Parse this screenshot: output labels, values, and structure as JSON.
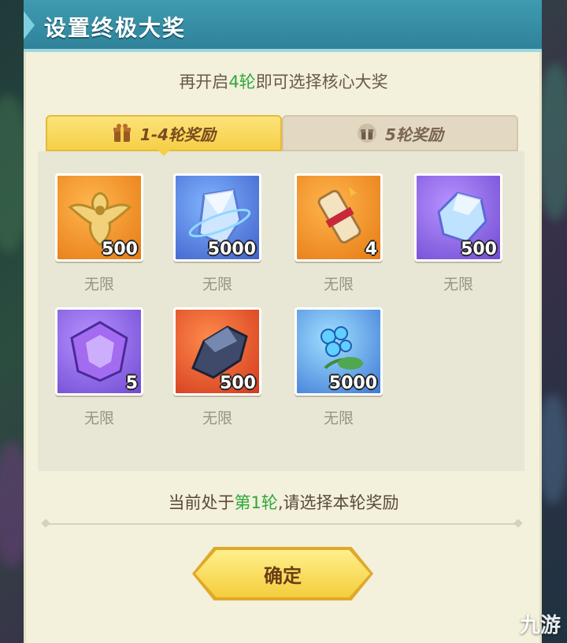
{
  "dialog": {
    "title": "设置终极大奖",
    "subtitle_prefix": "再开启",
    "subtitle_highlight": "4轮",
    "subtitle_suffix": "即可选择核心大奖"
  },
  "tabs": [
    {
      "label": "1-4轮奖励",
      "icon": "gift-box-icon",
      "active": true
    },
    {
      "label": "5轮奖励",
      "icon": "gift-box-icon",
      "active": false
    }
  ],
  "rewards": [
    {
      "icon": "golden-phoenix-emblem-icon",
      "quantity": "500",
      "limit": "无限",
      "bg": "orange"
    },
    {
      "icon": "blue-crystal-icon",
      "quantity": "5000",
      "limit": "无限",
      "bg": "blue"
    },
    {
      "icon": "scroll-icon",
      "quantity": "4",
      "limit": "无限",
      "bg": "orange"
    },
    {
      "icon": "ice-ore-icon",
      "quantity": "500",
      "limit": "无限",
      "bg": "purple"
    },
    {
      "icon": "purple-gem-icon",
      "quantity": "5",
      "limit": "无限",
      "bg": "purple"
    },
    {
      "icon": "dark-ore-icon",
      "quantity": "500",
      "limit": "无限",
      "bg": "red"
    },
    {
      "icon": "blue-flower-icon",
      "quantity": "5000",
      "limit": "无限",
      "bg": "cyan"
    }
  ],
  "status": {
    "prefix": "当前处于",
    "highlight": "第1轮",
    "suffix": ",请选择本轮奖励"
  },
  "confirm_label": "确定",
  "watermark": "九游",
  "colors": {
    "header": "#2f8299",
    "highlight_green": "#2ea83b",
    "tab_active": "#f6cf46",
    "button": "#f4cd3c"
  }
}
